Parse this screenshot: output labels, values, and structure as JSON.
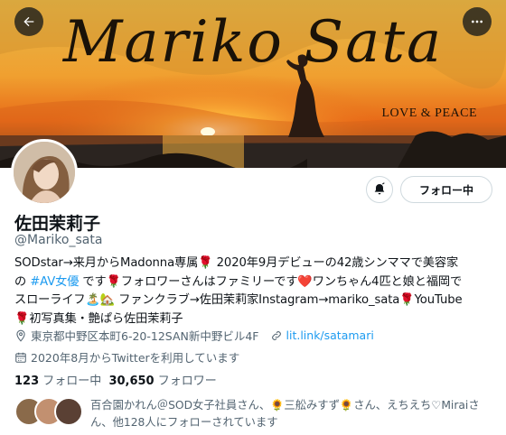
{
  "banner": {
    "title": "Mariko Sata",
    "subtitle": "LOVE & PEACE"
  },
  "nav": {
    "back_icon": "arrow-left-icon",
    "more_icon": "more-horizontal-icon"
  },
  "actions": {
    "notification_icon": "bell-icon",
    "follow_label": "フォロー中"
  },
  "profile": {
    "name": "佐田茉莉子",
    "handle": "@Mariko_sata",
    "bio_lines": [
      [
        "SODstar→来月からMadonna専属🌹 2020年9月デビューの42歳シンママで美容家"
      ],
      [
        "の ",
        "#AV女優",
        " です🌹フォロワーさんはファミリーです❤️ワンちゃん4匹と娘と福岡で"
      ],
      [
        "スローライフ🏝️🏡 ファンクラブ→佐田茉莉家Instagram→mariko_sata🌹YouTube"
      ],
      [
        "🌹初写真集・艶ぱら佐田茉莉子"
      ]
    ],
    "location": "東京都中野区本町6-20-12SAN新中野ビル4F",
    "website": "lit.link/satamari",
    "joined": "2020年8月からTwitterを利用しています",
    "following_count": "123",
    "following_label": "フォロー中",
    "followers_count": "30,650",
    "followers_label": "フォロワー",
    "known_followers": "百合園かれん＠SOD女子社員さん、🌻三舩みすず🌻さん、えちえち♡Miraiさん、他128人にフォローされています"
  },
  "colors": {
    "accent": "#1d9bf0",
    "muted_text": "#536471"
  }
}
